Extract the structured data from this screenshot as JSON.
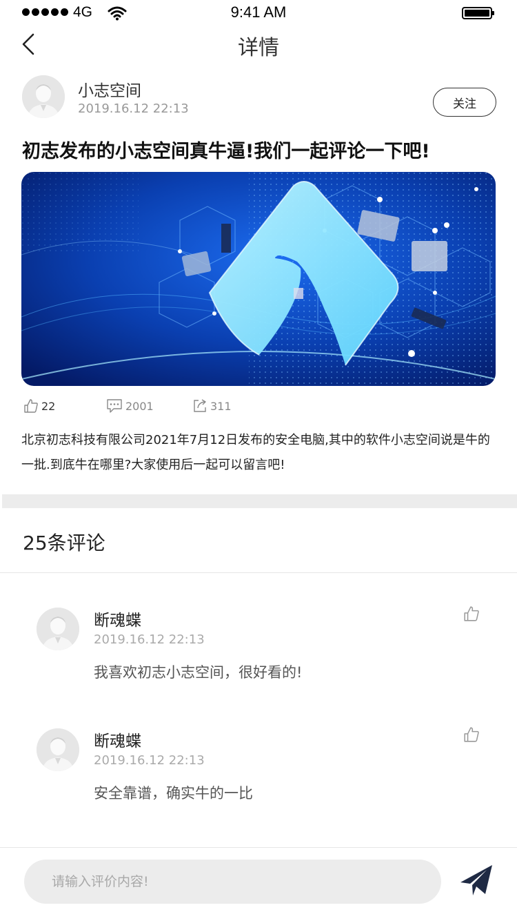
{
  "status_bar": {
    "network": "4G",
    "time": "9:41 AM"
  },
  "nav": {
    "title": "详情"
  },
  "author": {
    "name": "小志空间",
    "time": "2019.16.12 22:13",
    "follow_label": "关注"
  },
  "post": {
    "title": "初志发布的小志空间真牛逼!我们一起评论一下吧!",
    "likes": "22",
    "comments": "2001",
    "shares": "311",
    "body": "北京初志科技有限公司2021年7月12日发布的安全电脑,其中的软件小志空间说是牛的一批.到底牛在哪里?大家使用后一起可以留言吧!"
  },
  "comments_section": {
    "title": "25条评论",
    "items": [
      {
        "name": "断魂蝶",
        "time": "2019.16.12 22:13",
        "text": "我喜欢初志小志空间，很好看的!"
      },
      {
        "name": "断魂蝶",
        "time": "2019.16.12 22:13",
        "text": "安全靠谱，确实牛的一比"
      }
    ]
  },
  "compose": {
    "placeholder": "请输入评价内容!"
  },
  "colors": {
    "accent": "#1f2a44",
    "hero_blue": "#0a3fb0",
    "band": "#ececec"
  }
}
